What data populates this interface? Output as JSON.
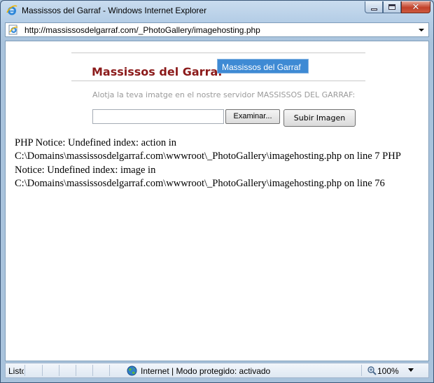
{
  "window": {
    "title": "Massissos del Garraf - Windows Internet Explorer",
    "url": "http://massissosdelgarraf.com/_PhotoGallery/imagehosting.php"
  },
  "page": {
    "site_title": "Massissos del Garraf",
    "tab_label": "Massissos del Garraf",
    "intro_text": "Alotja la teva imatge en el nostre servidor MASSISSOS DEL GARRAF:",
    "file_input_value": "",
    "browse_button": "Examinar...",
    "upload_button": "Subir Imagen",
    "notice_text": "PHP Notice: Undefined index: action in C:\\Domains\\massissosdelgarraf.com\\wwwroot\\_PhotoGallery\\imagehosting.php on line 7 PHP Notice: Undefined index: image in C:\\Domains\\massissosdelgarraf.com\\wwwroot\\_PhotoGallery\\imagehosting.php on line 76"
  },
  "status": {
    "text": "Listo",
    "zone": "Internet | Modo protegido: activado",
    "zoom": "100%"
  },
  "colors": {
    "site_title": "#8b1a1a",
    "tab_background": "#3e8ad4",
    "intro_text": "#9a9a9a",
    "frame": "#a9c3dc"
  },
  "icons": {
    "app": "ie-icon",
    "address": "ie-page-icon",
    "zone": "globe-icon",
    "zoom": "magnifier-icon"
  }
}
